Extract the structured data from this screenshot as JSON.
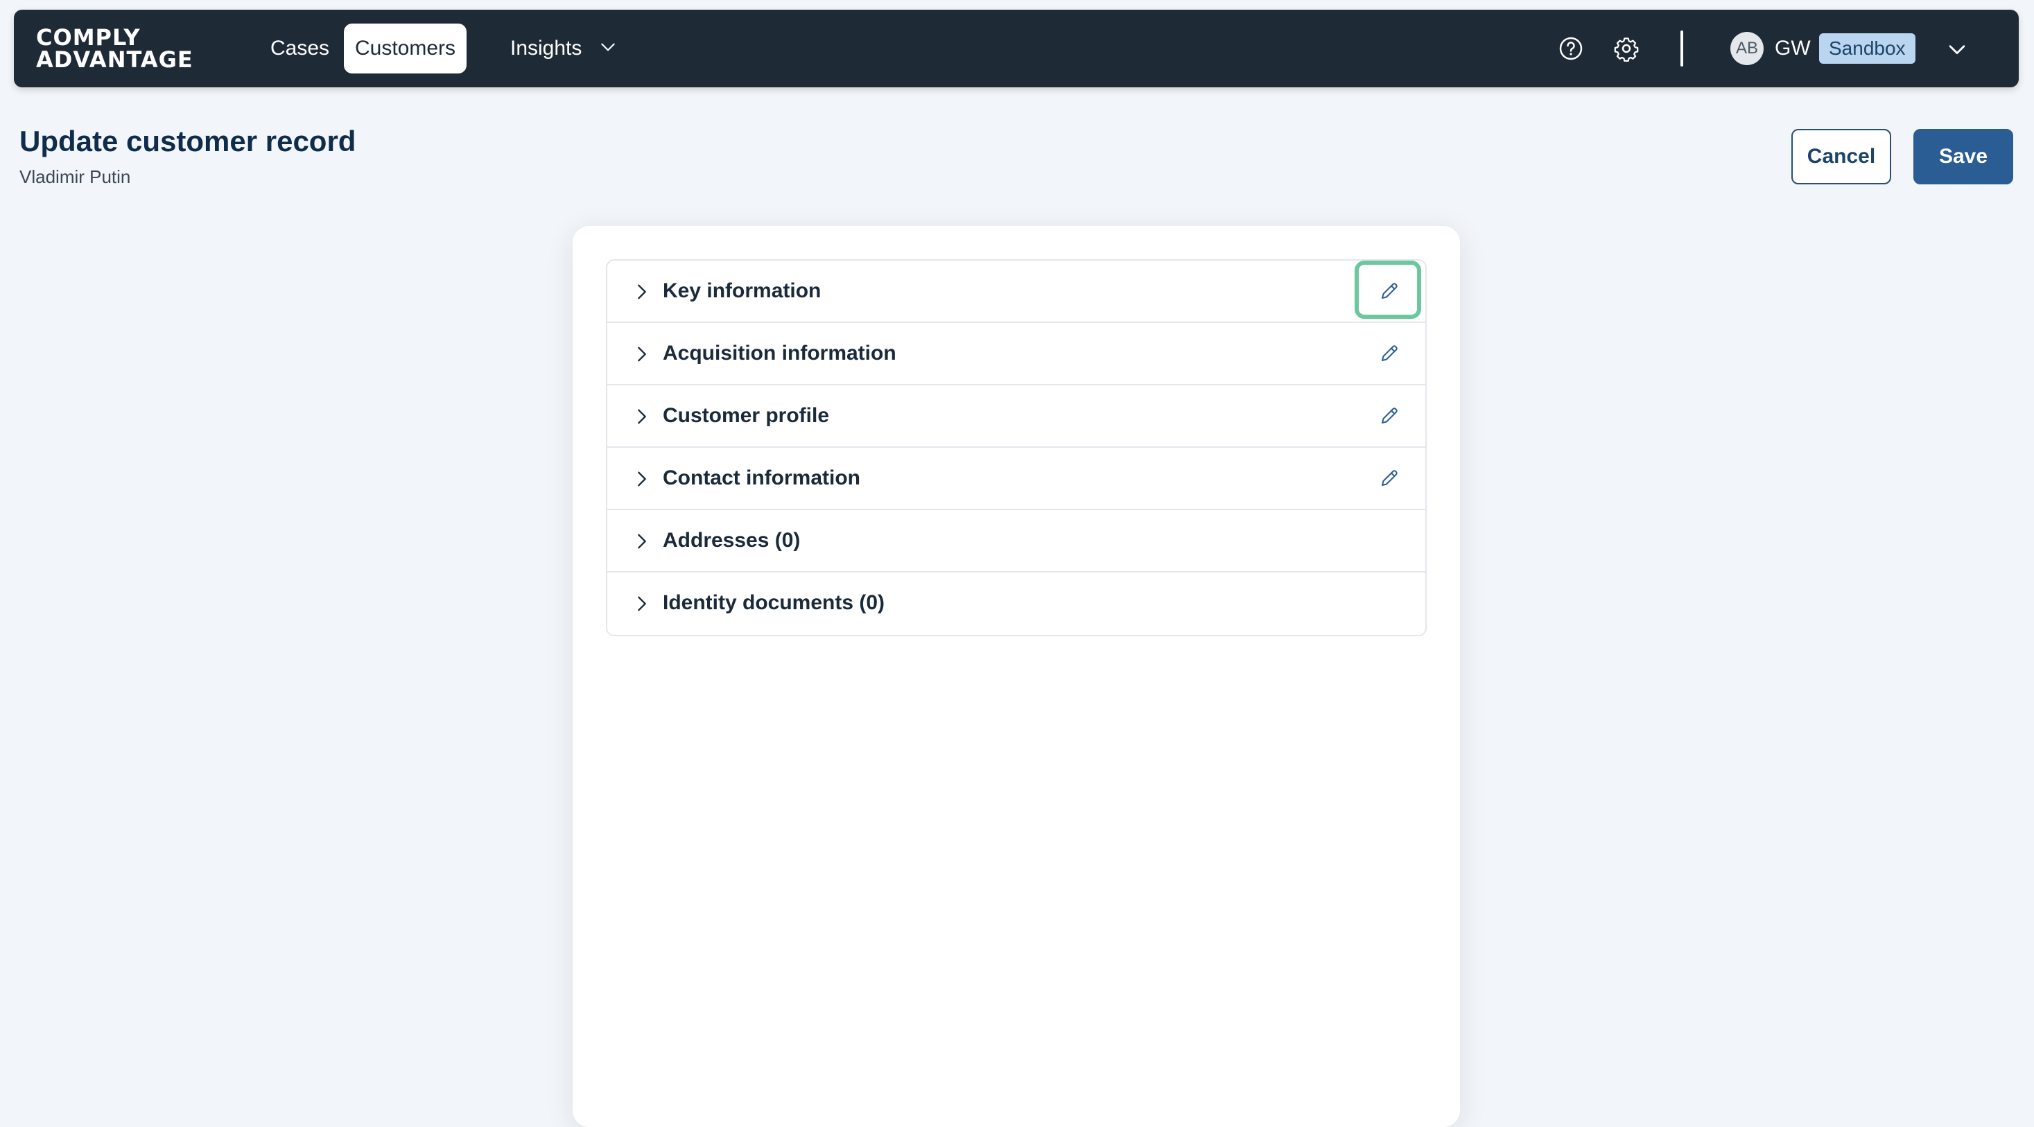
{
  "app": {
    "logo_line1": "COMPLY",
    "logo_line2": "ADVANTAGE"
  },
  "nav": {
    "cases_label": "Cases",
    "customers_label": "Customers",
    "insights_label": "Insights",
    "active": "Customers"
  },
  "user": {
    "avatar_initials": "AB",
    "initials": "GW",
    "environment": "Sandbox"
  },
  "page": {
    "title": "Update customer record",
    "subtitle": "Vladimir Putin"
  },
  "actions": {
    "cancel_label": "Cancel",
    "save_label": "Save"
  },
  "sections": [
    {
      "label": "Key information",
      "editable": true,
      "focused": true
    },
    {
      "label": "Acquisition information",
      "editable": true,
      "focused": false
    },
    {
      "label": "Customer profile",
      "editable": true,
      "focused": false
    },
    {
      "label": "Contact information",
      "editable": true,
      "focused": false
    },
    {
      "label": "Addresses (0)",
      "editable": false,
      "focused": false
    },
    {
      "label": "Identity documents (0)",
      "editable": false,
      "focused": false
    }
  ],
  "icons": {
    "help": "help-icon",
    "settings": "gear-icon",
    "dropdown": "chevron-down-icon",
    "expand": "chevron-right-icon",
    "edit": "pencil-icon"
  },
  "colors": {
    "nav_bg": "#1f2a37",
    "primary": "#2a5d94",
    "focus_ring": "#6cc79e",
    "badge_bg": "#b9d5ef",
    "page_bg": "#f2f5f9"
  }
}
